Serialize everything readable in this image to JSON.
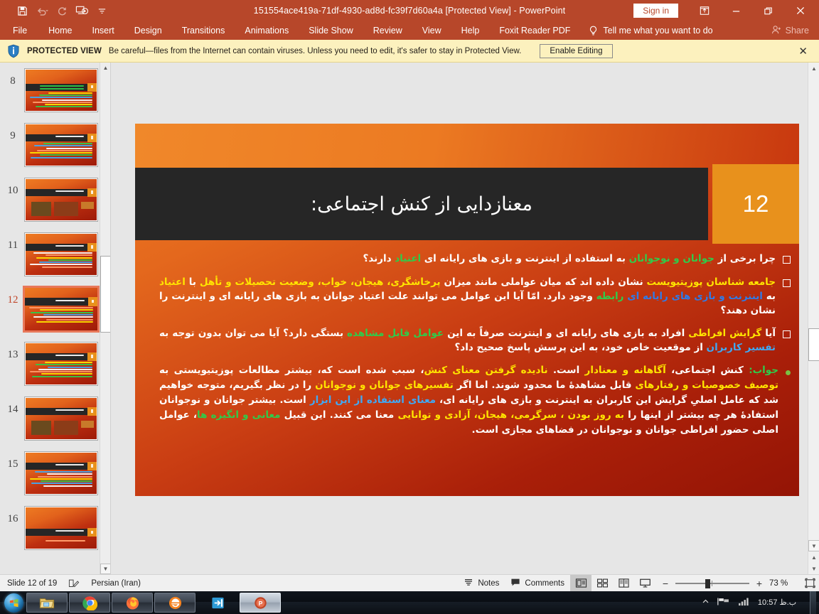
{
  "titlebar": {
    "document_title": "151554ace419a-71df-4930-ad8d-fc39f7d60a4a [Protected View]  -  PowerPoint",
    "sign_in": "Sign in",
    "qat": [
      {
        "name": "save-icon",
        "label": "Save"
      },
      {
        "name": "undo-icon",
        "label": "Undo"
      },
      {
        "name": "redo-icon",
        "label": "Redo"
      },
      {
        "name": "start-from-beginning-icon",
        "label": "Start From Beginning"
      },
      {
        "name": "customize-quick-access-toolbar-icon",
        "label": "Customize Quick Access Toolbar"
      }
    ],
    "window": {
      "ribbon_display_options": "Ribbon Display Options",
      "minimize": "Minimize",
      "restore": "Restore Down",
      "close": "Close"
    }
  },
  "ribbon": {
    "tabs": [
      "File",
      "Home",
      "Insert",
      "Design",
      "Transitions",
      "Animations",
      "Slide Show",
      "Review",
      "View",
      "Help",
      "Foxit Reader PDF"
    ],
    "tell_me": "Tell me what you want to do",
    "share": "Share"
  },
  "protected_view": {
    "label": "PROTECTED VIEW",
    "message": "Be careful—files from the Internet can contain viruses. Unless you need to edit, it's safer to stay in Protected View.",
    "enable_button": "Enable Editing",
    "close": "✕"
  },
  "thumbnails": {
    "items": [
      {
        "number": "8",
        "layout": "title-body",
        "selected": false
      },
      {
        "number": "9",
        "layout": "title-body",
        "selected": false
      },
      {
        "number": "10",
        "layout": "title-images",
        "selected": false
      },
      {
        "number": "11",
        "layout": "title-body",
        "selected": false
      },
      {
        "number": "12",
        "layout": "title-body",
        "selected": true
      },
      {
        "number": "13",
        "layout": "title-body",
        "selected": false
      },
      {
        "number": "14",
        "layout": "title-images",
        "selected": false
      },
      {
        "number": "15",
        "layout": "title-body",
        "selected": false
      },
      {
        "number": "16",
        "layout": "title-only",
        "selected": false
      }
    ]
  },
  "slide": {
    "number": "12",
    "title": "معنازدایی از کنش اجتماعی:",
    "paragraphs": [
      {
        "bullet": "square",
        "runs": [
          {
            "t": "چرا برخی از ",
            "c": "#FFFFFF"
          },
          {
            "t": "جوانان و نوجوانان",
            "c": "#2FCC4A"
          },
          {
            "t": " به استفاده از اینترنت و بازی های رایانه ای ",
            "c": "#FFFFFF"
          },
          {
            "t": "اعتیاد",
            "c": "#2FCC4A"
          },
          {
            "t": " دارند؟",
            "c": "#FFFFFF"
          }
        ]
      },
      {
        "bullet": "square",
        "runs": [
          {
            "t": "جامعه شناسان پوزیتیویست",
            "c": "#FFE400"
          },
          {
            "t": " نشان داده اند که میان عواملی مانند میزان ",
            "c": "#FFFFFF"
          },
          {
            "t": "پرخاشگری، هیجان، خواب، وضعیت تحصیلات و تأهل",
            "c": "#FFE400"
          },
          {
            "t": " با ",
            "c": "#FFFFFF"
          },
          {
            "t": "اعتیاد",
            "c": "#FFE400"
          },
          {
            "t": " به ",
            "c": "#FFFFFF"
          },
          {
            "t": "اینترنت و بازی های رایانه ای",
            "c": "#2F7BE8"
          },
          {
            "t": " ",
            "c": "#FFFFFF"
          },
          {
            "t": "رابطه",
            "c": "#2FCC4A"
          },
          {
            "t": " وجود دارد. امّا آیا این عوامل می توانند علت اعتیاد جوانان به بازی های رایانه ای و اینترنت را نشان دهند؟",
            "c": "#FFFFFF"
          }
        ]
      },
      {
        "bullet": "square",
        "runs": [
          {
            "t": "آیا ",
            "c": "#FFFFFF"
          },
          {
            "t": "گرایش افراطی",
            "c": "#FFE400"
          },
          {
            "t": " افراد به بازی های رایانه ای و اینترنت صرفاً به این ",
            "c": "#FFFFFF"
          },
          {
            "t": "عوامل قابل مشاهده",
            "c": "#2FCC4A"
          },
          {
            "t": " بستگی دارد؟ آیا می توان بدون توجه به ",
            "c": "#FFFFFF"
          },
          {
            "t": "تفسیر کاربران",
            "c": "#3FA9F5"
          },
          {
            "t": " از موقعیت خاص خود، به این پرسش پاسخ صحیح داد؟",
            "c": "#FFFFFF"
          }
        ]
      },
      {
        "bullet": "dot",
        "runs": [
          {
            "t": "جواب:",
            "c": "#2FCC4A"
          },
          {
            "t": " کنش اجتماعی، ",
            "c": "#FFFFFF"
          },
          {
            "t": "آگاهانه و معنادار",
            "c": "#FFE400"
          },
          {
            "t": " است. ",
            "c": "#FFFFFF"
          },
          {
            "t": "نادیده گرفتن معنای کنش",
            "c": "#FFE400"
          },
          {
            "t": "، سبب شده است که، بیشتر مطالعات پوزیتیویستی به ",
            "c": "#FFFFFF"
          },
          {
            "t": "توصیف خصوصیات و رفتارهای",
            "c": "#FFE400"
          },
          {
            "t": " قابل مشاهدۀ ما محدود شوند. اما اگر ",
            "c": "#FFFFFF"
          },
          {
            "t": "تفسیرهای جوانان و نوجوانان",
            "c": "#FFE400"
          },
          {
            "t": " را در نظر بگیریم، متوجه خواهیم شد که عامل اصلیِ گرایش این کاربران به اینترنت و بازی های رایانه ای، ",
            "c": "#FFFFFF"
          },
          {
            "t": "معنای استفاده از این ابزار",
            "c": "#3FA9F5"
          },
          {
            "t": " است. بیشتر جوانان و نوجوانان استفادۀ هر چه بیشتر از اینها را ",
            "c": "#FFFFFF"
          },
          {
            "t": "به روز بودن ، سرگرمی، هیجان، آزادی و توانایی",
            "c": "#FFE400"
          },
          {
            "t": " معنا می کنند. این قبیل ",
            "c": "#FFFFFF"
          },
          {
            "t": "معانی و انگیزه ها",
            "c": "#2FCC4A"
          },
          {
            "t": "، عوامل اصلی حضور افراطی جوانان و نوجوانان در فضاهای مجازی است.",
            "c": "#FFFFFF"
          }
        ]
      }
    ]
  },
  "status_bar": {
    "slide_indicator": "Slide 12 of 19",
    "spell_check": "spell-check",
    "language": "Persian (Iran)",
    "notes": "Notes",
    "comments": "Comments",
    "views": [
      "Normal",
      "Slide Sorter",
      "Reading View",
      "Slide Show"
    ],
    "zoom_value": "73 %",
    "fit_slide": "Fit slide to current window"
  },
  "taskbar": {
    "start": "Start",
    "apps": [
      {
        "name": "file-explorer-icon",
        "label": "File Explorer"
      },
      {
        "name": "google-chrome-icon",
        "label": "Google Chrome"
      },
      {
        "name": "firefox-icon",
        "label": "Mozilla Firefox"
      },
      {
        "name": "internet-explorer-icon",
        "label": "Internet Explorer"
      },
      {
        "name": "blue-arrow-icon",
        "label": "App"
      },
      {
        "name": "powerpoint-icon",
        "label": "PowerPoint"
      }
    ],
    "clock": "10:57 ب.ظ"
  },
  "colors": {
    "brand": "#B7472A",
    "accent_orange": "#E8911C",
    "title_band": "#262626",
    "protected_bg": "#FCF1BE"
  }
}
